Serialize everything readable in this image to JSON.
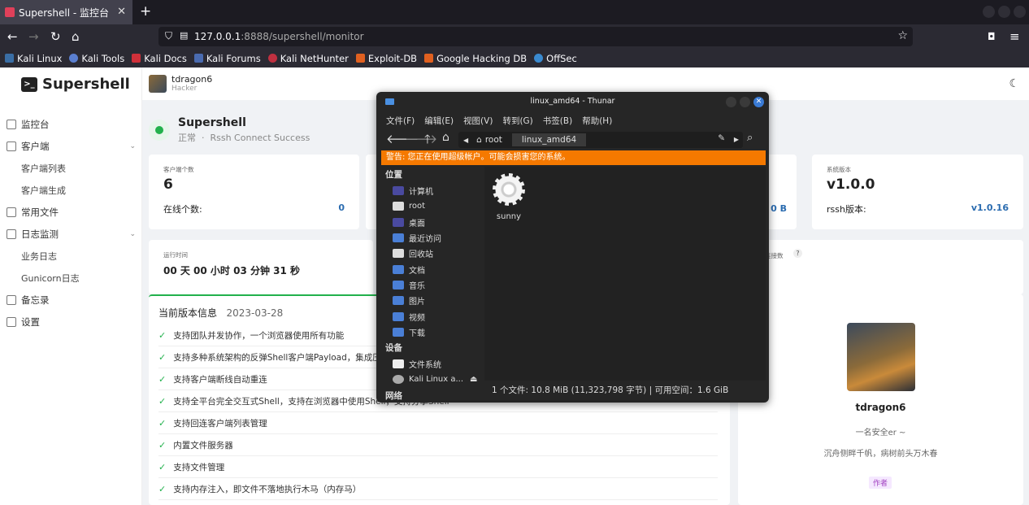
{
  "browser": {
    "tab_title": "Supershell - 监控台",
    "url_host": "127.0.0.1",
    "url_rest": ":8888/supershell/monitor",
    "bookmarks": [
      "Kali Linux",
      "Kali Tools",
      "Kali Docs",
      "Kali Forums",
      "Kali NetHunter",
      "Exploit-DB",
      "Google Hacking DB",
      "OffSec"
    ]
  },
  "app": {
    "logo": "Supershell",
    "user": {
      "name": "tdragon6",
      "role": "Hacker"
    },
    "menu": [
      {
        "label": "监控台",
        "sub": false
      },
      {
        "label": "客户端",
        "sub": false,
        "chev": true
      },
      {
        "label": "客户端列表",
        "sub": true
      },
      {
        "label": "客户端生成",
        "sub": true
      },
      {
        "label": "常用文件",
        "sub": false
      },
      {
        "label": "日志监测",
        "sub": false,
        "chev": true
      },
      {
        "label": "业务日志",
        "sub": true
      },
      {
        "label": "Gunicorn日志",
        "sub": true
      },
      {
        "label": "备忘录",
        "sub": false
      },
      {
        "label": "设置",
        "sub": false
      }
    ],
    "status": {
      "title": "Supershell",
      "state": "正常",
      "detail": "Rssh Connect Success"
    },
    "stats": {
      "clients_label": "客户端个数",
      "clients_value": "6",
      "online_label": "在线个数:",
      "online_value": "0",
      "traffic_value": "0 B",
      "version_label": "系统版本",
      "version_value": "v1.0.0",
      "rssh_label": "rssh版本:",
      "rssh_value": "v1.0.16"
    },
    "uptime": {
      "label": "运行时间",
      "value": "00 天 00 小时 03 分钟 31 秒"
    },
    "conn_label": "连接数",
    "release": {
      "title": "当前版本信息",
      "date": "2023-03-28"
    },
    "features": [
      "支持团队并发协作，一个浏览器使用所有功能",
      "支持多种系统架构的反弹Shell客户端Payload，集成压",
      "支持客户端断线自动重连",
      "支持全平台完全交互式Shell，支持在浏览器中使用Shell，支持分享Shell",
      "支持回连客户端列表管理",
      "内置文件服务器",
      "支持文件管理",
      "支持内存注入，即文件不落地执行木马（内存马）"
    ],
    "profile": {
      "name": "tdragon6",
      "line1": "一名安全er ~",
      "line2": "沉舟侧畔千帆，病树前头万木春",
      "tag": "作者"
    }
  },
  "thunar": {
    "title": "linux_amd64 - Thunar",
    "menu": [
      "文件(F)",
      "编辑(E)",
      "视图(V)",
      "转到(G)",
      "书签(B)",
      "帮助(H)"
    ],
    "crumbs": [
      "root",
      "linux_amd64"
    ],
    "warning": "警告: 您正在使用超级帐户。可能会损害您的系统。",
    "places_head": "位置",
    "places": [
      "计算机",
      "root",
      "桌面",
      "最近访问",
      "回收站",
      "文档",
      "音乐",
      "图片",
      "视频",
      "下载"
    ],
    "devices_head": "设备",
    "devices": [
      "文件系统",
      "Kali Linux a..."
    ],
    "network_head": "网络",
    "file": "sunny",
    "statusbar": "1 个文件: 10.8 MiB (11,323,798 字节) | 可用空间：1.6 GiB"
  }
}
